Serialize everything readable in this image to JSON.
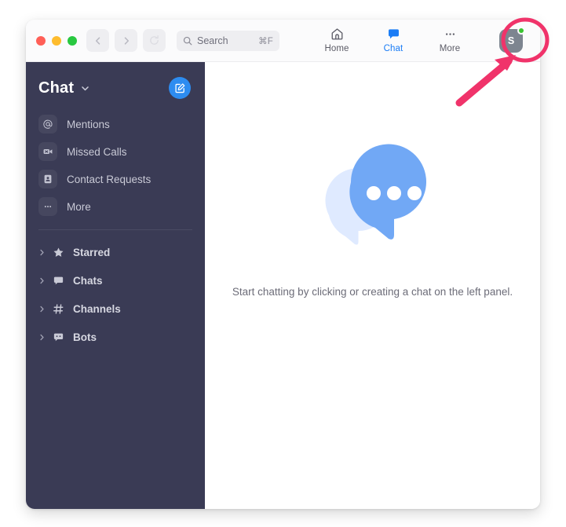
{
  "window": {
    "traffic_lights": [
      {
        "name": "close",
        "color": "#ff5f57"
      },
      {
        "name": "minimize",
        "color": "#febc2e"
      },
      {
        "name": "maximize",
        "color": "#28c840"
      }
    ]
  },
  "toolbar": {
    "back_icon": "chevron-left-icon",
    "forward_icon": "chevron-right-icon",
    "refresh_icon": "refresh-icon",
    "search": {
      "icon": "search-icon",
      "placeholder": "Search",
      "shortcut": "⌘F"
    },
    "tabs": [
      {
        "label": "Home",
        "icon": "home-icon",
        "active": false
      },
      {
        "label": "Chat",
        "icon": "chat-bubble-icon",
        "active": true
      },
      {
        "label": "More",
        "icon": "ellipsis-icon",
        "active": false
      }
    ],
    "avatar": {
      "initial": "S",
      "presence": "online",
      "presence_color": "#3ac430",
      "background_color": "#7d8590"
    }
  },
  "sidebar": {
    "title": "Chat",
    "caret_icon": "chevron-down-icon",
    "compose_button": {
      "icon": "compose-icon",
      "color": "#2d8cf0"
    },
    "items": [
      {
        "label": "Mentions",
        "icon": "at-icon"
      },
      {
        "label": "Missed Calls",
        "icon": "missed-video-call-icon"
      },
      {
        "label": "Contact Requests",
        "icon": "contact-card-icon"
      },
      {
        "label": "More",
        "icon": "ellipsis-icon"
      }
    ],
    "sections": [
      {
        "label": "Starred",
        "icon": "star-icon",
        "caret": "chevron-right-icon",
        "expanded": false
      },
      {
        "label": "Chats",
        "icon": "chat-bubble-icon",
        "caret": "chevron-right-icon",
        "expanded": false
      },
      {
        "label": "Channels",
        "icon": "hash-icon",
        "caret": "chevron-right-icon",
        "expanded": false
      },
      {
        "label": "Bots",
        "icon": "bot-bubble-icon",
        "caret": "chevron-right-icon",
        "expanded": false
      }
    ]
  },
  "main": {
    "empty_state": {
      "illustration": "two-speech-bubbles-icon",
      "message": "Start chatting by clicking or creating a chat on the left panel.",
      "bubble_front_color": "#71a8f5",
      "bubble_back_color": "#dfeaff"
    }
  },
  "annotation": {
    "color": "#f0336a",
    "ellipse_target": "avatar",
    "arrow": "arrow-pointing-up-right"
  },
  "colors": {
    "sidebar_bg": "#3a3b55",
    "titlebar_bg": "#fbfbfc",
    "accent_blue": "#1a7cf5"
  }
}
